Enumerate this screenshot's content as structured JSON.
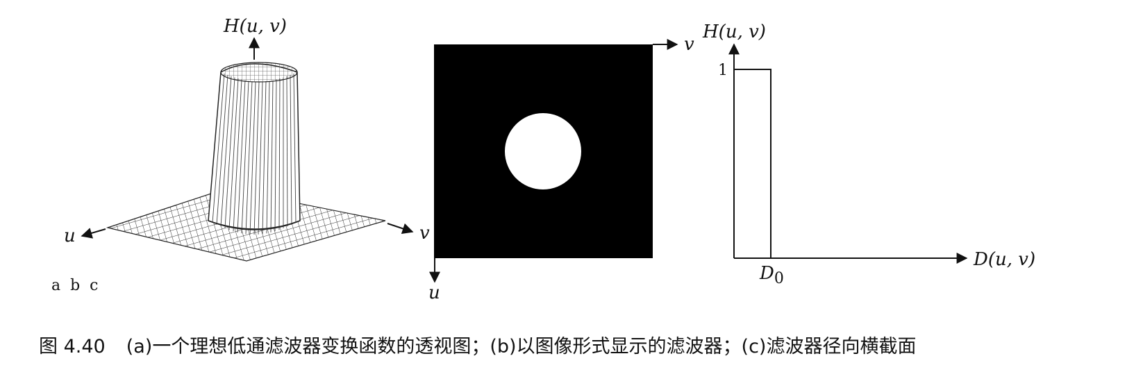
{
  "panel_a": {
    "label_h": "H(u, v)",
    "label_u": "u",
    "label_v": "v",
    "panel_letters": "a  b  c"
  },
  "panel_b": {
    "label_v": "v",
    "label_u": "u"
  },
  "panel_c": {
    "label_h": "H(u, v)",
    "label_one": "1",
    "label_d0": "D",
    "label_d0_sub": "0",
    "label_axis": "D(u, v)"
  },
  "caption": {
    "number": "图 4.40",
    "part_a": "(a)一个理想低通滤波器变换函数的透视图；",
    "part_b": "(b)以图像形式显示的滤波器；",
    "part_c": "(c)滤波器径向横截面"
  }
}
